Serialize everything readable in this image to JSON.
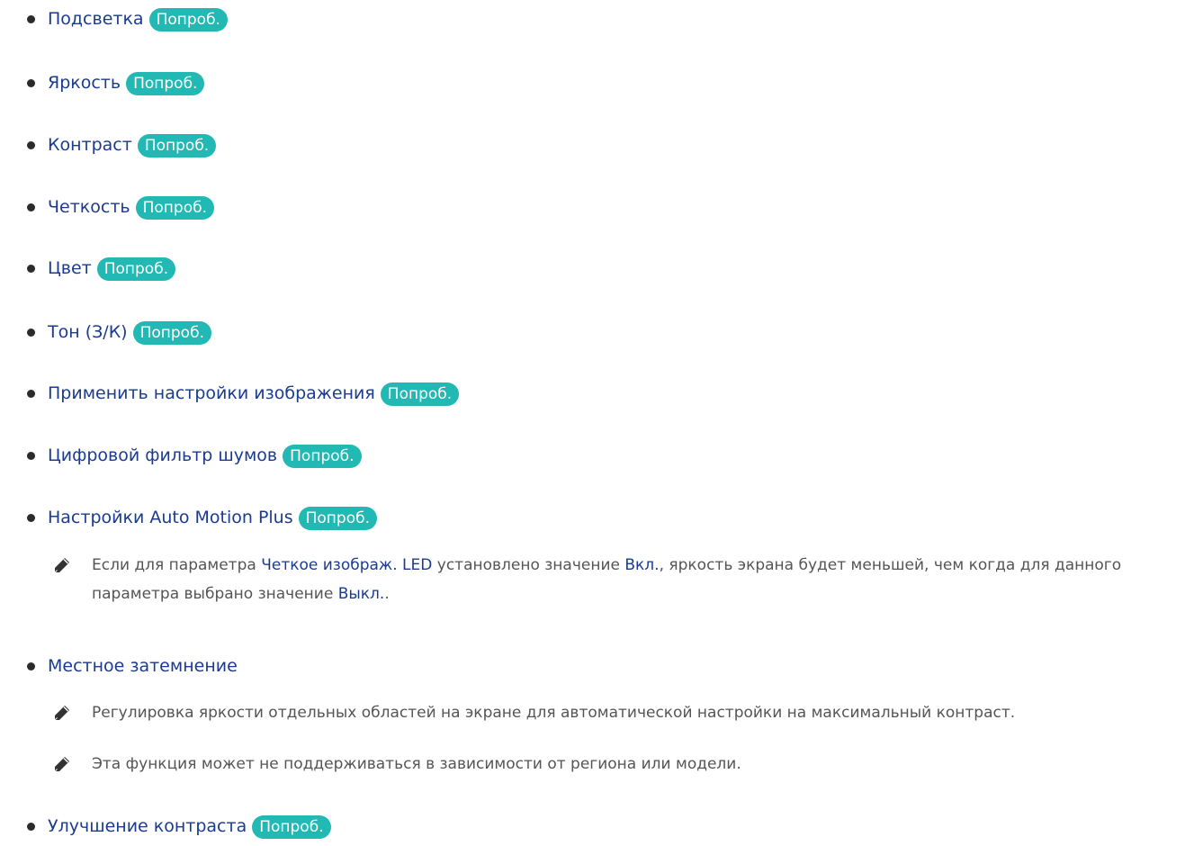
{
  "try_label": "Попроб.",
  "items": [
    {
      "label": "Подсветка"
    },
    {
      "label": "Яркость"
    },
    {
      "label": "Контраст"
    },
    {
      "label": "Четкость"
    },
    {
      "label": "Цвет"
    },
    {
      "label": "Тон (З/К)"
    },
    {
      "label": "Применить настройки изображения"
    },
    {
      "label": "Цифровой фильтр шумов"
    },
    {
      "label": "Настройки Auto Motion Plus"
    },
    {
      "label": "Местное затемнение"
    },
    {
      "label": "Улучшение контраста"
    }
  ],
  "note_motion": {
    "t1": "Если для параметра ",
    "h1": "Четкое изображ. LED",
    "t2": " установлено значение ",
    "h2": "Вкл.",
    "t3": ", яркость экрана будет меньшей, чем когда для данного параметра выбрано значение ",
    "h3": "Выкл.",
    "t4": "."
  },
  "note_dimming_1": "Регулировка яркости отдельных областей на экране для автоматической настройки на максимальный контраст.",
  "note_dimming_2": "Эта функция может не поддерживаться в зависимости от региона или модели.",
  "colors": {
    "link": "#1a3b8f",
    "badge": "#22b8b3",
    "text": "#555555"
  },
  "icons": {
    "note": "pencil-icon"
  }
}
